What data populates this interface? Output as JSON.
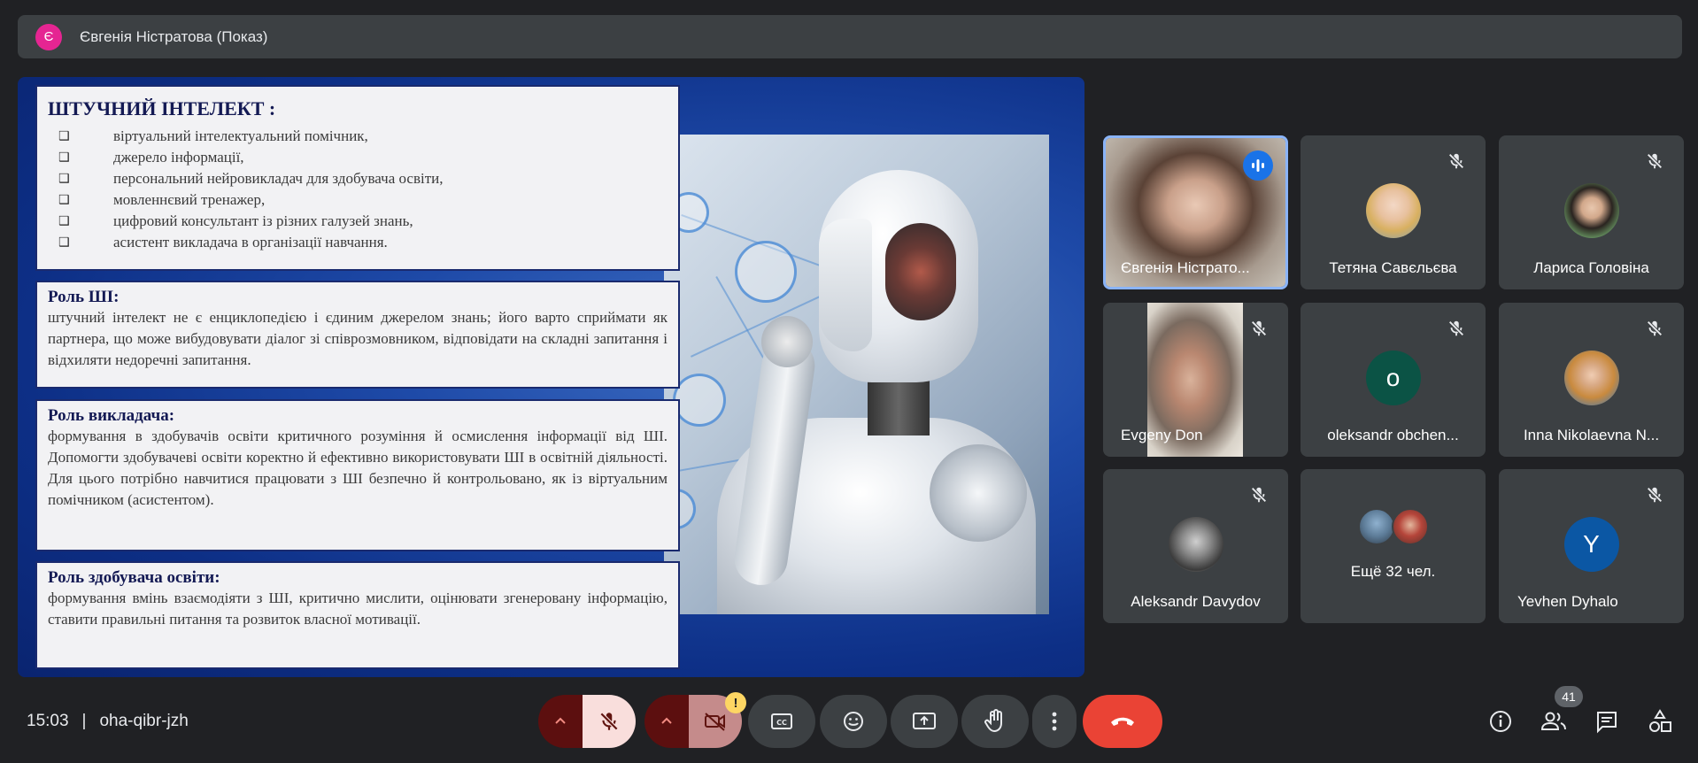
{
  "presenter": {
    "avatar_letter": "Є",
    "name": "Євгенія Ністратова (Показ)"
  },
  "slide": {
    "box1": {
      "title": "ШТУЧНИЙ ІНТЕЛЕКТ :",
      "bullet_glyph": "❑",
      "items": [
        "віртуальний інтелектуальний помічник,",
        "джерело інформації,",
        "персональний нейровикладач для здобувача освіти,",
        "мовленнєвий тренажер,",
        "цифровий консультант із різних галузей знань,",
        "асистент викладача в організації навчання."
      ]
    },
    "box2": {
      "title": "Роль ШІ:",
      "text": "штучний інтелект не є енциклопедією і єдиним джерелом знань; його варто сприймати як партнера, що може вибудовувати діалог зі співрозмовником, відповідати на складні запитання і відхиляти недоречні запитання."
    },
    "box3": {
      "title": "Роль викладача:",
      "text": "формування в здобувачів освіти критичного розуміння й осмислення інформації від ШІ. Допомогти здобувачеві освіти коректно й ефективно використовувати ШІ в освітній діяльності. Для цього потрібно навчитися працювати з ШІ безпечно й контрольовано, як із віртуальним помічником (асистентом)."
    },
    "box4": {
      "title": "Роль здобувача освіти:",
      "text": "формування вмінь взаємодіяти з ШІ,  критично мислити, оцінювати згенеровану інформацію, ставити правильні питання та розвиток власної мотивації."
    }
  },
  "participants": [
    {
      "name": "Євгенія Ністрато...",
      "status": "speaking"
    },
    {
      "name": "Тетяна Савєльєва",
      "status": "muted"
    },
    {
      "name": "Лариса Головіна",
      "status": "muted"
    },
    {
      "name": "Evgeny Don",
      "status": "muted"
    },
    {
      "name": "oleksandr obchen...",
      "status": "muted",
      "avatar_letter": "o",
      "avatar_color": "#0b5345"
    },
    {
      "name": "Inna Nikolaevna N...",
      "status": "muted"
    },
    {
      "name": "Aleksandr Davydov",
      "status": "muted"
    },
    {
      "name": "Ещё 32 чел.",
      "status": "group"
    },
    {
      "name": "Yevhen Dyhalo",
      "status": "muted",
      "avatar_letter": "Y",
      "avatar_color": "#0b57a4"
    }
  ],
  "meeting": {
    "time": "15:03",
    "separator": "|",
    "code": "oha-qibr-jzh",
    "people_count": "41",
    "camera_warning": "!"
  },
  "colors": {
    "accent_blue": "#8ab4f8",
    "end_call_red": "#ea4335",
    "mic_off_bg": "#f9dedc",
    "cam_off_bg": "#c58b8b",
    "caret_bg": "#5c0f0f"
  }
}
